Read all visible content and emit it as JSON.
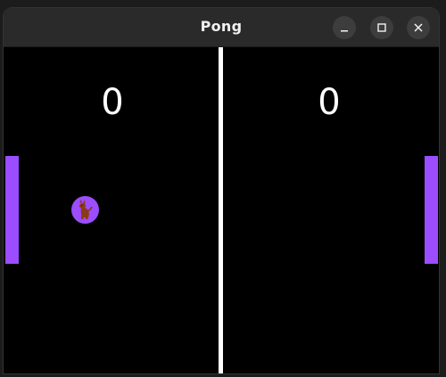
{
  "window": {
    "title": "Pong",
    "controls": {
      "minimize_icon": "minimize-icon",
      "maximize_icon": "maximize-icon",
      "close_icon": "close-icon"
    }
  },
  "game": {
    "scores": {
      "left": "0",
      "right": "0"
    },
    "colors": {
      "background": "#000000",
      "net": "#ffffff",
      "paddle": "#9b4dff",
      "ball": "#9b4dff",
      "ball_figure": "#8b3a16"
    },
    "ball_icon": "dog-icon"
  }
}
